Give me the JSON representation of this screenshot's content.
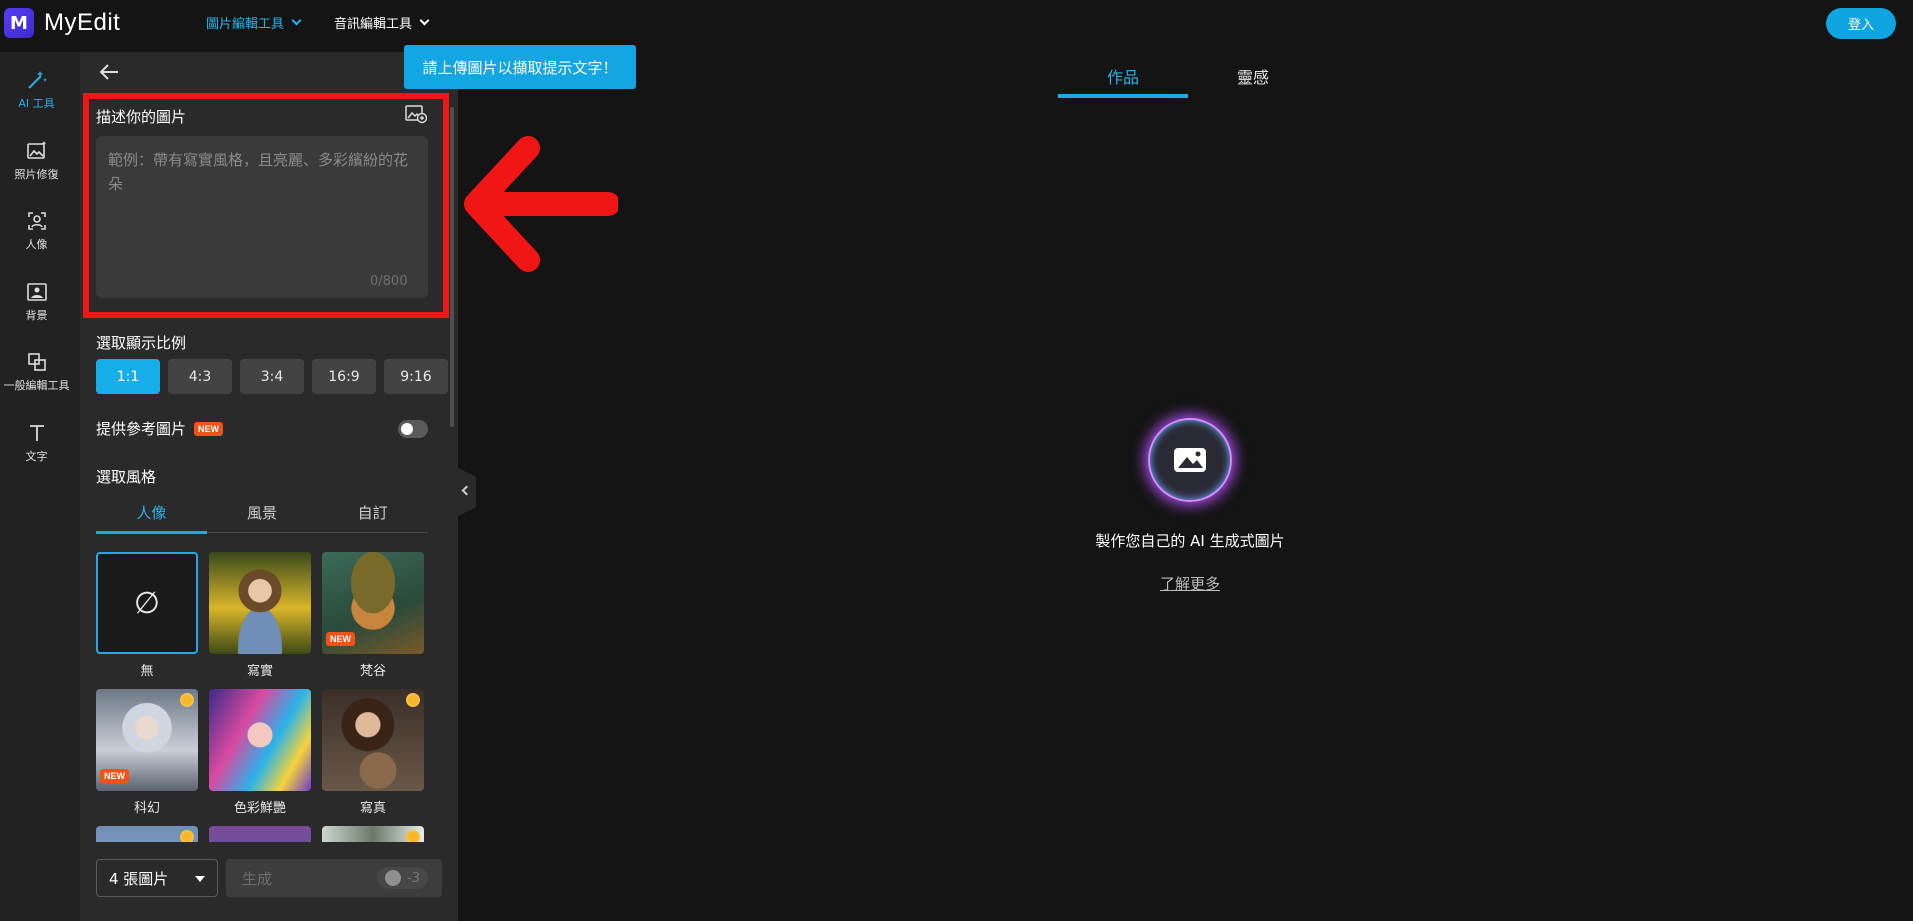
{
  "app": {
    "name": "MyEdit"
  },
  "topnav": {
    "items": [
      {
        "label": "圖片編輯工具"
      },
      {
        "label": "音訊編輯工具"
      }
    ],
    "login_label": "登入"
  },
  "leftrail": {
    "items": [
      {
        "label": "AI 工具"
      },
      {
        "label": "照片修復"
      },
      {
        "label": "人像"
      },
      {
        "label": "背景"
      },
      {
        "label": "一般編輯工具"
      },
      {
        "label": "文字"
      }
    ]
  },
  "tooltip": "請上傳圖片以擷取提示文字！",
  "prompt": {
    "label": "描述你的圖片",
    "placeholder": "範例：帶有寫實風格，且亮麗、多彩繽紛的花朵",
    "value": "",
    "counter": "0/800"
  },
  "ratio": {
    "label": "選取顯示比例",
    "options": [
      "1:1",
      "4:3",
      "3:4",
      "16:9",
      "9:16"
    ],
    "selected": "1:1"
  },
  "reference": {
    "label": "提供參考圖片",
    "badge": "NEW",
    "enabled": false
  },
  "style": {
    "label": "選取風格",
    "tabs": [
      "人像",
      "風景",
      "自訂"
    ],
    "active_tab": "人像",
    "thumbs": [
      {
        "caption": "無",
        "glyph": "∅"
      },
      {
        "caption": "寫實"
      },
      {
        "caption": "梵谷",
        "badge": "NEW"
      },
      {
        "caption": "科幻",
        "badge": "NEW"
      },
      {
        "caption": "色彩鮮艷"
      },
      {
        "caption": "寫真"
      }
    ]
  },
  "bottom": {
    "count_select": "4 張圖片",
    "generate_label": "生成",
    "credit": "-3"
  },
  "main": {
    "tabs": [
      "作品",
      "靈感"
    ],
    "active_tab": "作品",
    "empty_text": "製作您自己的 AI 生成式圖片",
    "learn_more": "了解更多"
  },
  "colors": {
    "accent": "#1fa8e3",
    "highlight": "#f01616",
    "badge": "#f0521a"
  }
}
